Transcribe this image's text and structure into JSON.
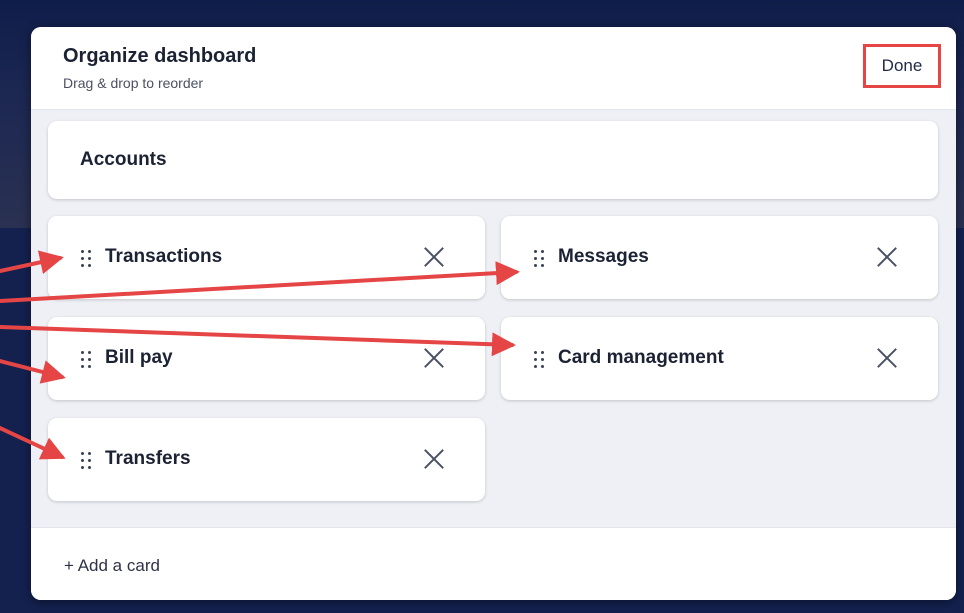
{
  "dialog": {
    "title": "Organize dashboard",
    "subtitle": "Drag & drop to reorder",
    "done_label": "Done",
    "add_card_label": "+ Add a card"
  },
  "pinned_card": {
    "label": "Accounts"
  },
  "cards": [
    {
      "label": "Transactions"
    },
    {
      "label": "Messages"
    },
    {
      "label": "Bill pay"
    },
    {
      "label": "Card management"
    },
    {
      "label": "Transfers"
    }
  ],
  "colors": {
    "annotation": "#e54545",
    "backdrop": "#0b1840",
    "modal_body": "#eef0f5",
    "card": "#ffffff",
    "text": "#1b2233"
  },
  "icons": {
    "drag": "drag-handle-icon",
    "remove": "close-icon"
  }
}
